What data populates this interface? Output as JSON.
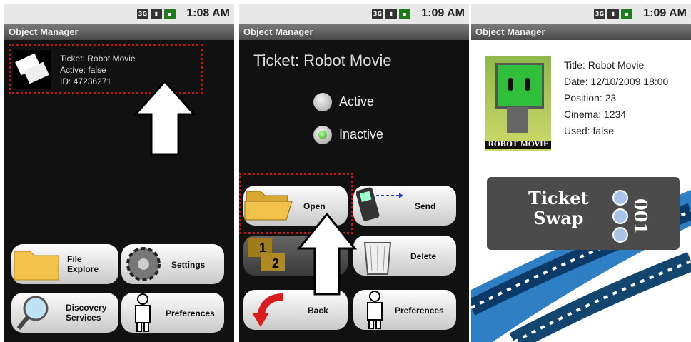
{
  "screens": [
    {
      "status_icons": [
        "3G",
        "signal",
        "battery"
      ],
      "clock": "1:08 AM",
      "title": "Object Manager",
      "item": {
        "lines": [
          "Ticket: Robot Movie",
          "Active: false",
          "ID: 47236271"
        ]
      },
      "tiles": [
        {
          "label_lines": [
            "File",
            "Explore"
          ],
          "icon": "folder-icon"
        },
        {
          "label_lines": [
            "Settings"
          ],
          "icon": "gear-icon"
        },
        {
          "label_lines": [
            "Discovery",
            "Services"
          ],
          "icon": "magnifier-icon"
        },
        {
          "label_lines": [
            "Preferences"
          ],
          "icon": "person-icon"
        }
      ]
    },
    {
      "status_icons": [
        "3G",
        "signal",
        "battery"
      ],
      "clock": "1:09 AM",
      "title": "Object Manager",
      "heading": "Ticket: Robot Movie",
      "radios": [
        {
          "label": "Active",
          "selected": false
        },
        {
          "label": "Inactive",
          "selected": true
        }
      ],
      "tiles": [
        {
          "label_lines": [
            "Open"
          ],
          "icon": "open-folder-icon"
        },
        {
          "label_lines": [
            "Send"
          ],
          "icon": "phone-send-icon"
        },
        {
          "label_lines": [
            ""
          ],
          "icon": "numbered-folders-icon",
          "overlay_text": [
            "1",
            "2"
          ]
        },
        {
          "label_lines": [
            "Delete"
          ],
          "icon": "trash-icon"
        },
        {
          "label_lines": [
            "Back"
          ],
          "icon": "back-arrow-icon"
        },
        {
          "label_lines": [
            "Preferences"
          ],
          "icon": "person-icon"
        }
      ]
    },
    {
      "status_icons": [
        "3G",
        "signal",
        "battery"
      ],
      "clock": "1:09 AM",
      "title": "Object Manager",
      "details": [
        "Title: Robot Movie",
        "Date: 12/10/2009 18:00",
        "Position: 23",
        "Cinema: 1234",
        "Used: false"
      ],
      "poster_caption": "ROBOT MOVIE",
      "ticket_text": [
        "Ticket",
        "Swap"
      ],
      "ticket_number": "001"
    }
  ],
  "colors": {
    "highlight": "#c01818",
    "accent_green": "#2da21b",
    "folder": "#f2c24a"
  }
}
